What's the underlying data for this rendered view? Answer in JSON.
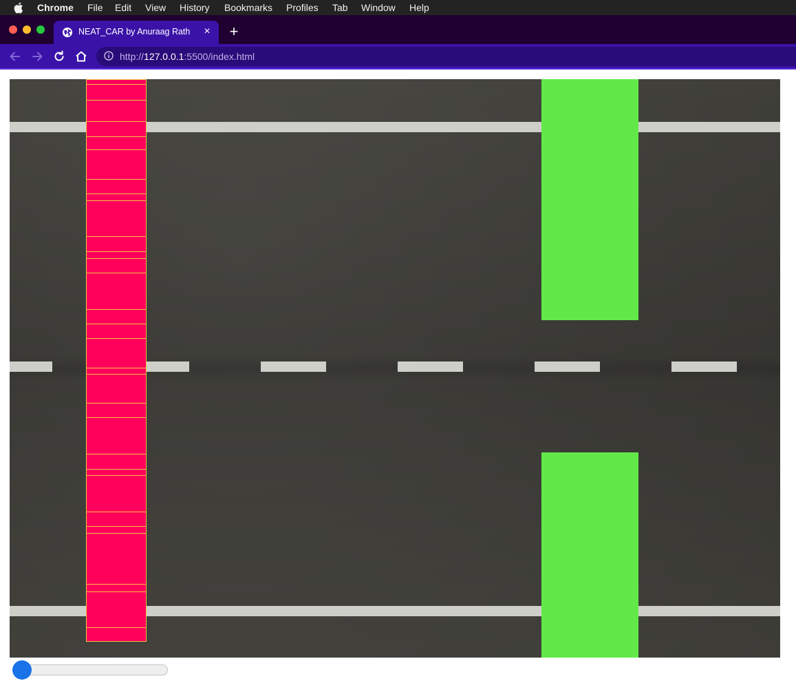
{
  "menubar": {
    "app_name": "Chrome",
    "items": [
      "File",
      "Edit",
      "View",
      "History",
      "Bookmarks",
      "Profiles",
      "Tab",
      "Window",
      "Help"
    ]
  },
  "tab": {
    "title": "NEAT_CAR by Anuraag Rath",
    "close_glyph": "×",
    "new_tab_glyph": "+"
  },
  "address_bar": {
    "scheme": "http://",
    "host": "127.0.0.1",
    "rest": ":5500/index.html"
  },
  "colors": {
    "menubar": "#232323",
    "tabstrip": "#1f0030",
    "toolbar": "#3a12a8",
    "car": "#ff005a",
    "car_outline": "#f3c544",
    "obstacle": "#63e84a",
    "road_marking": "#cfcfca",
    "slider_thumb": "#1a73e8"
  },
  "icons": {
    "apple": "apple-icon",
    "back": "arrow-left-icon",
    "forward": "arrow-right-icon",
    "reload": "reload-icon",
    "home": "home-icon",
    "info": "info-icon",
    "tab_favicon": "globe-icon"
  },
  "slider": {
    "value_fraction": 0
  }
}
